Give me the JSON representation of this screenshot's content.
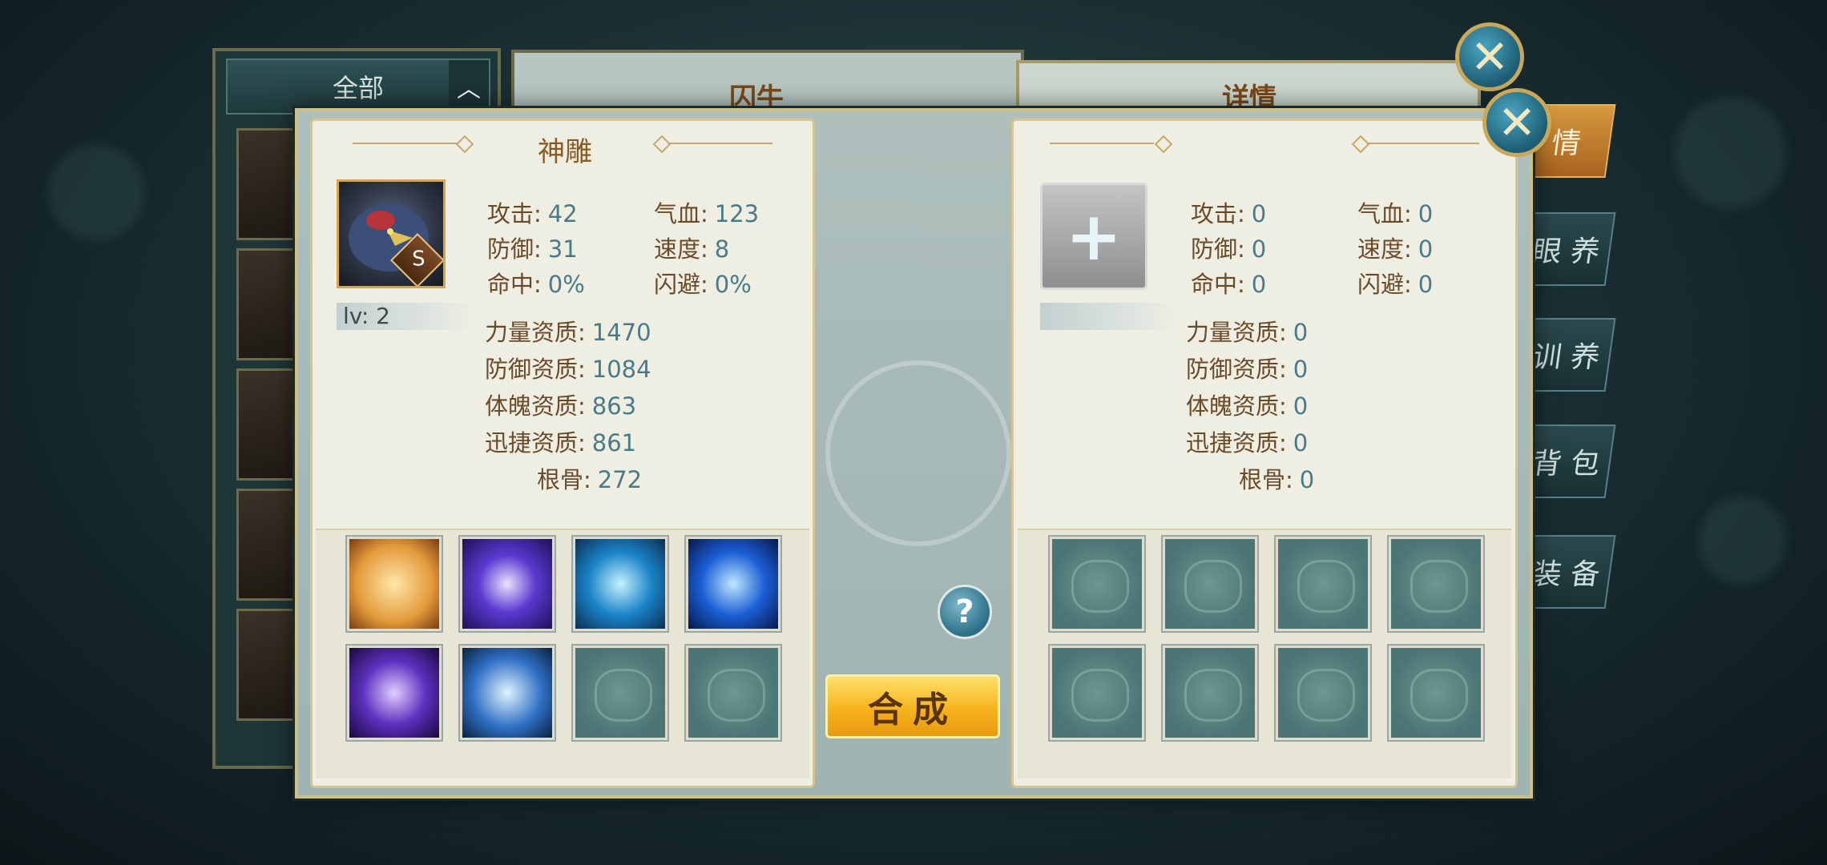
{
  "background": {
    "filter_label": "全部",
    "middle_title": "囚牛",
    "right_title": "详情",
    "side_tabs": [
      {
        "label": "情",
        "active": true
      },
      {
        "label": "眼 养",
        "active": false
      },
      {
        "label": "训 养",
        "active": false
      },
      {
        "label": "背 包",
        "active": false
      },
      {
        "label": "装 备",
        "active": false
      }
    ]
  },
  "left_pet": {
    "name": "神雕",
    "grade": "S",
    "level_label": "lv: 2",
    "stats": [
      {
        "key": "攻击:",
        "value": "42"
      },
      {
        "key": "气血:",
        "value": "123"
      },
      {
        "key": "防御:",
        "value": "31"
      },
      {
        "key": "速度:",
        "value": "8"
      },
      {
        "key": "命中:",
        "value": "0%"
      },
      {
        "key": "闪避:",
        "value": "0%"
      }
    ],
    "aptitudes": [
      {
        "key": "力量资质:",
        "value": "1470"
      },
      {
        "key": "防御资质:",
        "value": "1084"
      },
      {
        "key": "体魄资质:",
        "value": "863"
      },
      {
        "key": "迅捷资质:",
        "value": "861"
      },
      {
        "key": "根骨:",
        "value": "272"
      }
    ],
    "skills": [
      {
        "icon": "golden-beast-skill-icon",
        "color": "#e39a3a"
      },
      {
        "icon": "purple-orb-skill-icon",
        "color": "#5a3ad0"
      },
      {
        "icon": "blue-crossed-blades-skill-icon",
        "color": "#1a84c7"
      },
      {
        "icon": "blue-wolf-skill-icon",
        "color": "#1b5fd6"
      },
      {
        "icon": "purple-vortex-skill-icon",
        "color": "#5e2fbf"
      },
      {
        "icon": "blue-heart-skill-icon",
        "color": "#2f6fc4"
      },
      {
        "icon": "empty-slot",
        "color": ""
      },
      {
        "icon": "empty-slot",
        "color": ""
      }
    ]
  },
  "right_pet": {
    "add_icon": "plus-icon",
    "stats": [
      {
        "key": "攻击:",
        "value": "0"
      },
      {
        "key": "气血:",
        "value": "0"
      },
      {
        "key": "防御:",
        "value": "0"
      },
      {
        "key": "速度:",
        "value": "0"
      },
      {
        "key": "命中:",
        "value": "0"
      },
      {
        "key": "闪避:",
        "value": "0"
      }
    ],
    "aptitudes": [
      {
        "key": "力量资质:",
        "value": "0"
      },
      {
        "key": "防御资质:",
        "value": "0"
      },
      {
        "key": "体魄资质:",
        "value": "0"
      },
      {
        "key": "迅捷资质:",
        "value": "0"
      },
      {
        "key": "根骨:",
        "value": "0"
      }
    ]
  },
  "controls": {
    "compose_label": "合成",
    "help_label": "?",
    "close_glyph": "✕"
  },
  "colors": {
    "accent_gold": "#c7a86a",
    "stat_value_blue": "#4a7a88",
    "compose_button": "#f6b31d"
  }
}
